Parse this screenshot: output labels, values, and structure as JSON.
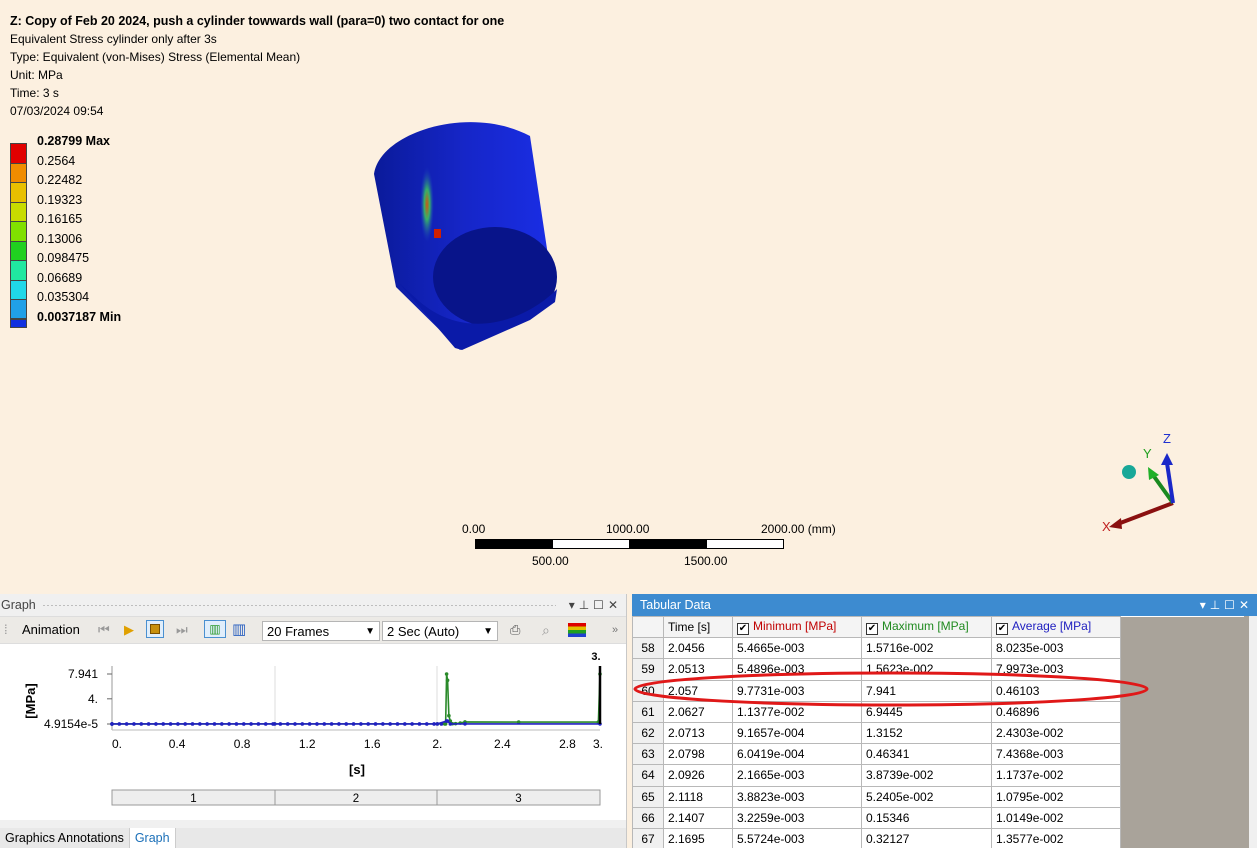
{
  "result": {
    "title": "Z: Copy of Feb 20 2024, push a cylinder towwards wall (para=0) two contact for one",
    "name": "Equivalent Stress cylinder only after 3s",
    "type": "Type: Equivalent (von-Mises) Stress (Elemental Mean)",
    "unit": "Unit: MPa",
    "time": "Time: 3 s",
    "date": "07/03/2024 09:54"
  },
  "legend": [
    {
      "label": "0.28799 Max",
      "color": "#e10000",
      "bold": true
    },
    {
      "label": "0.2564",
      "color": "#f08c00",
      "bold": false
    },
    {
      "label": "0.22482",
      "color": "#e8c000",
      "bold": false
    },
    {
      "label": "0.19323",
      "color": "#c8dc00",
      "bold": false
    },
    {
      "label": "0.16165",
      "color": "#80e000",
      "bold": false
    },
    {
      "label": "0.13006",
      "color": "#20d020",
      "bold": false
    },
    {
      "label": "0.098475",
      "color": "#20e8a0",
      "bold": false
    },
    {
      "label": "0.06689",
      "color": "#20d8e8",
      "bold": false
    },
    {
      "label": "0.035304",
      "color": "#20a0e8",
      "bold": false
    },
    {
      "label": "0.0037187 Min",
      "color": "#1030e0",
      "bold": true
    }
  ],
  "scale_bar": {
    "t0": "0.00",
    "t1": "1000.00",
    "t2": "2000.00 (mm)",
    "b1": "500.00",
    "b2": "1500.00"
  },
  "triad": {
    "x": "X",
    "y": "Y",
    "z": "Z"
  },
  "graph_panel": {
    "title": "Graph",
    "animation_label": "Animation",
    "frames": "20 Frames",
    "speed": "2 Sec (Auto)",
    "tabs": [
      "Graphics Annotations",
      "Graph"
    ]
  },
  "chart_data": {
    "type": "line",
    "ylabel": "[MPa]",
    "xlabel": "[s]",
    "yticks": [
      "7.941",
      "4.",
      "4.9154e-5"
    ],
    "xticks": [
      "0.",
      "0.4",
      "0.8",
      "1.2",
      "1.6",
      "2.",
      "2.4",
      "2.8",
      "3."
    ],
    "top_marker": "3.",
    "xlim": [
      0,
      3
    ],
    "ylim": [
      0,
      7.941
    ],
    "steps": [
      "1",
      "2",
      "3"
    ],
    "series": [
      {
        "name": "Maximum [MPa]",
        "color": "#2a8a2a",
        "points": [
          [
            0,
            0.01
          ],
          [
            1.0,
            0.02
          ],
          [
            2.0,
            0.02
          ],
          [
            2.045,
            0.016
          ],
          [
            2.051,
            0.016
          ],
          [
            2.057,
            7.941
          ],
          [
            2.063,
            6.9445
          ],
          [
            2.071,
            1.3152
          ],
          [
            2.08,
            0.46341
          ],
          [
            2.093,
            0.038739
          ],
          [
            2.112,
            0.052405
          ],
          [
            2.141,
            0.15346
          ],
          [
            2.17,
            0.32127
          ],
          [
            2.5,
            0.3
          ],
          [
            2.99,
            0.3
          ],
          [
            3.0,
            7.941
          ]
        ]
      },
      {
        "name": "Average [MPa]",
        "color": "#2020c0",
        "points": [
          [
            0,
            0.005
          ],
          [
            1.0,
            0.008
          ],
          [
            2.0,
            0.008
          ],
          [
            2.057,
            0.46103
          ],
          [
            2.063,
            0.46896
          ],
          [
            2.08,
            0.0074368
          ],
          [
            2.17,
            0.013577
          ],
          [
            3.0,
            0.01
          ]
        ]
      }
    ]
  },
  "tabular": {
    "title": "Tabular Data",
    "headers": [
      "Time [s]",
      "Minimum [MPa]",
      "Maximum [MPa]",
      "Average [MPa]"
    ],
    "header_colors": [
      "#000000",
      "#c00000",
      "#1f8a1f",
      "#2020c0"
    ],
    "rows": [
      [
        "58",
        "2.0456",
        "5.4665e-003",
        "1.5716e-002",
        "8.0235e-003"
      ],
      [
        "59",
        "2.0513",
        "5.4896e-003",
        "1.5623e-002",
        "7.9973e-003"
      ],
      [
        "60",
        "2.057",
        "9.7731e-003",
        "7.941",
        "0.46103"
      ],
      [
        "61",
        "2.0627",
        "1.1377e-002",
        "6.9445",
        "0.46896"
      ],
      [
        "62",
        "2.0713",
        "9.1657e-004",
        "1.3152",
        "2.4303e-002"
      ],
      [
        "63",
        "2.0798",
        "6.0419e-004",
        "0.46341",
        "7.4368e-003"
      ],
      [
        "64",
        "2.0926",
        "2.1665e-003",
        "3.8739e-002",
        "1.1737e-002"
      ],
      [
        "65",
        "2.1118",
        "3.8823e-003",
        "5.2405e-002",
        "1.0795e-002"
      ],
      [
        "66",
        "2.1407",
        "3.2259e-003",
        "0.15346",
        "1.0149e-002"
      ],
      [
        "67",
        "2.1695",
        "5.5724e-003",
        "0.32127",
        "1.3577e-002"
      ]
    ]
  }
}
